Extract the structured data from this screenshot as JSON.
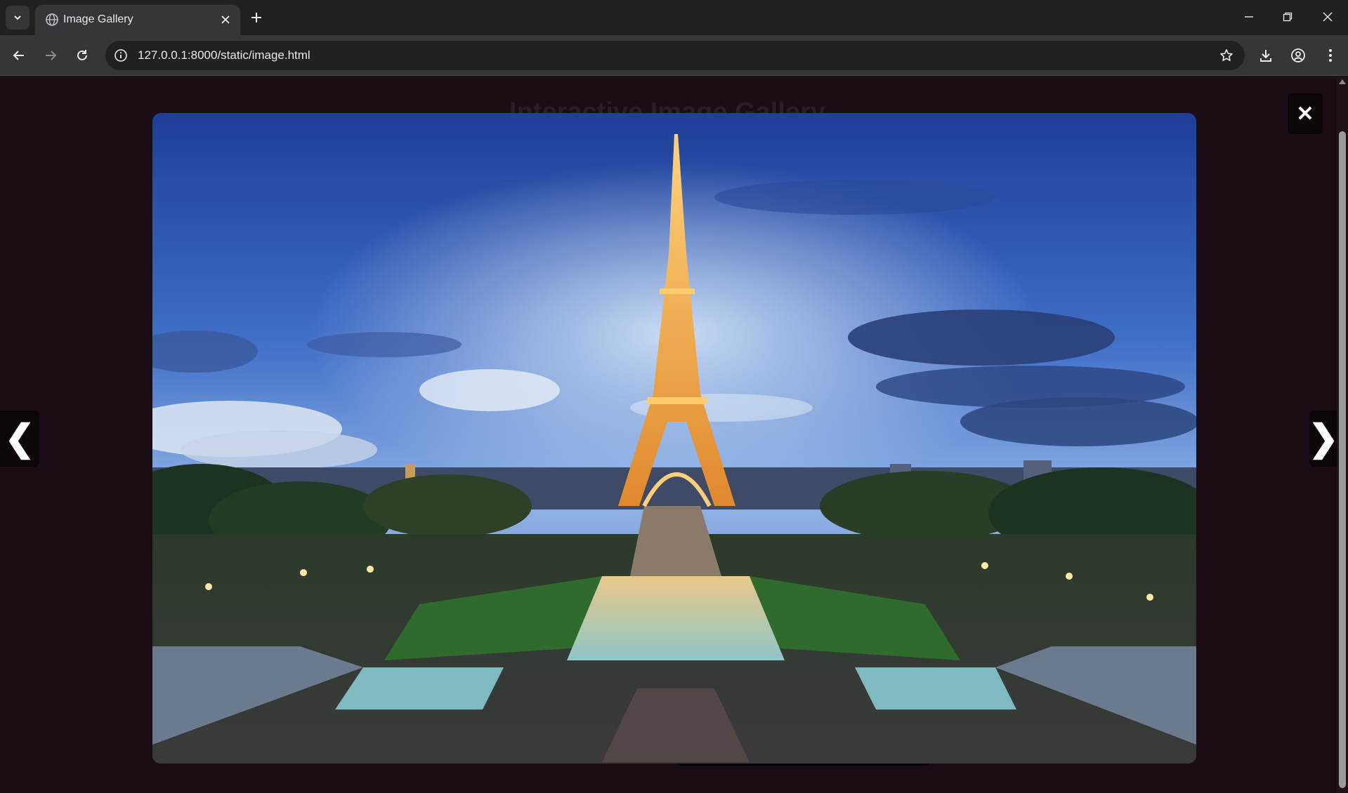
{
  "browser": {
    "tab_title": "Image Gallery",
    "url": "127.0.0.1:8000/static/image.html"
  },
  "page": {
    "heading": "Interactive Image Gallery"
  },
  "lightbox": {
    "close_label": "✕",
    "prev_label": "❮",
    "next_label": "❯"
  },
  "icons": {
    "tab_search": "chevron-down-icon",
    "favicon": "globe-icon",
    "tab_close": "close-icon",
    "new_tab": "plus-icon",
    "minimize": "minimize-icon",
    "restore": "restore-icon",
    "window_close": "close-icon",
    "back": "arrow-left-icon",
    "forward": "arrow-right-icon",
    "reload": "reload-icon",
    "site_info": "info-icon",
    "bookmark": "star-icon",
    "downloads": "download-icon",
    "profile": "profile-icon",
    "menu": "kebab-menu-icon"
  },
  "colors": {
    "page_background": "#1a0d15",
    "chrome_dark": "#202124",
    "chrome_toolbar": "#35363a"
  }
}
